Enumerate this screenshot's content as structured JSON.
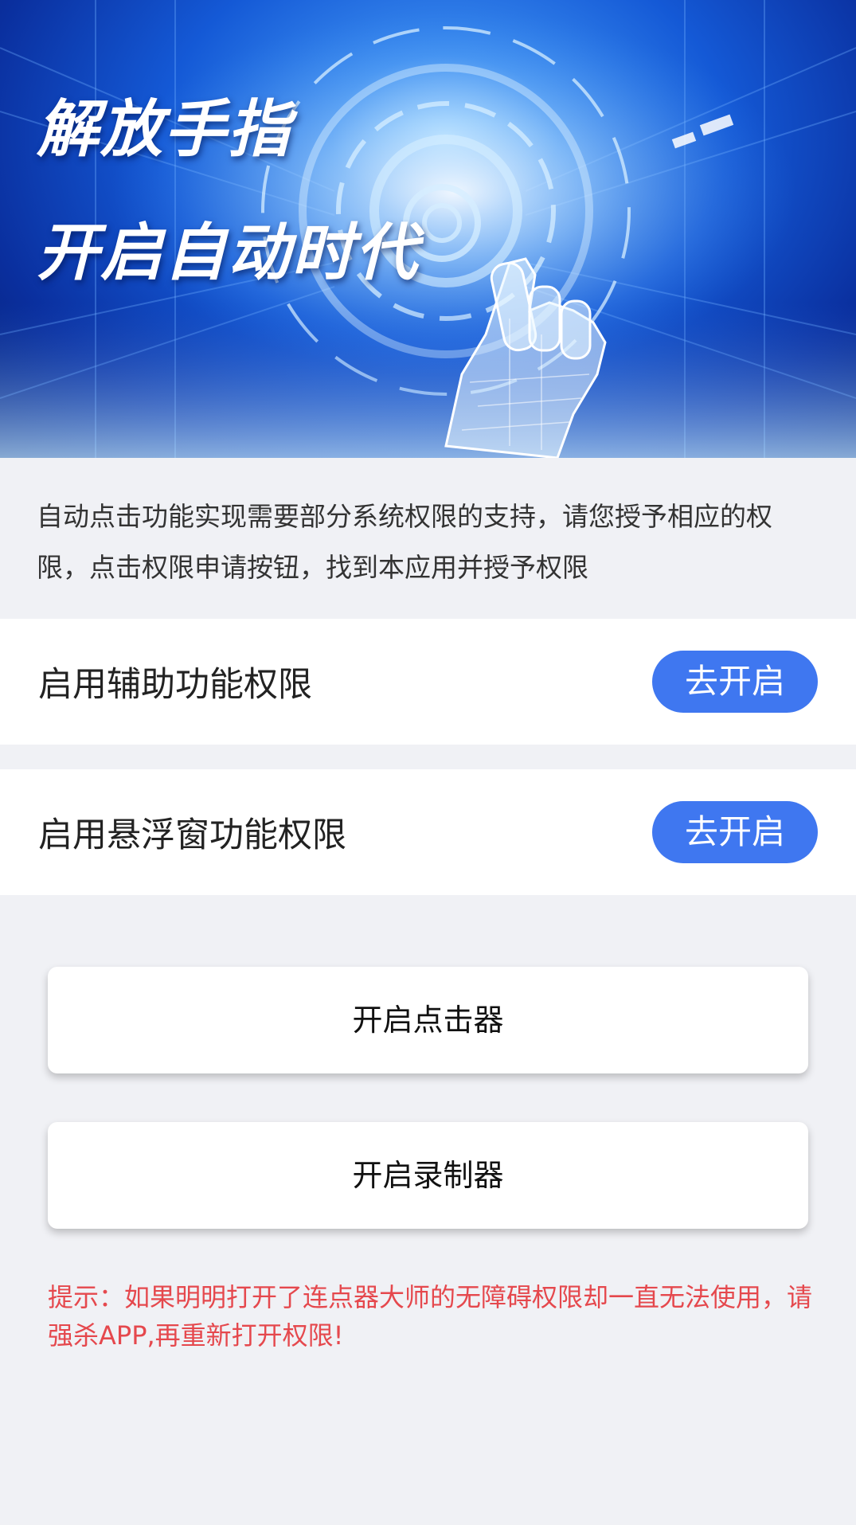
{
  "banner": {
    "title_line1": "解放手指",
    "title_line2": "开启自动时代"
  },
  "intro_text": "自动点击功能实现需要部分系统权限的支持，请您授予相应的权限，点击权限申请按钮，找到本应用并授予权限",
  "permissions": [
    {
      "label": "启用辅助功能权限",
      "button_label": "去开启"
    },
    {
      "label": "启用悬浮窗功能权限",
      "button_label": "去开启"
    }
  ],
  "actions": [
    {
      "label": "开启点击器"
    },
    {
      "label": "开启录制器"
    }
  ],
  "tip_text": "提示：如果明明打开了连点器大师的无障碍权限却一直无法使用，请强杀APP,再重新打开权限!",
  "colors": {
    "accent": "#3f77f0",
    "tip": "#e5484d",
    "background": "#f0f1f5"
  },
  "icons": {
    "banner_graphic": "robot-hand-illustration"
  }
}
